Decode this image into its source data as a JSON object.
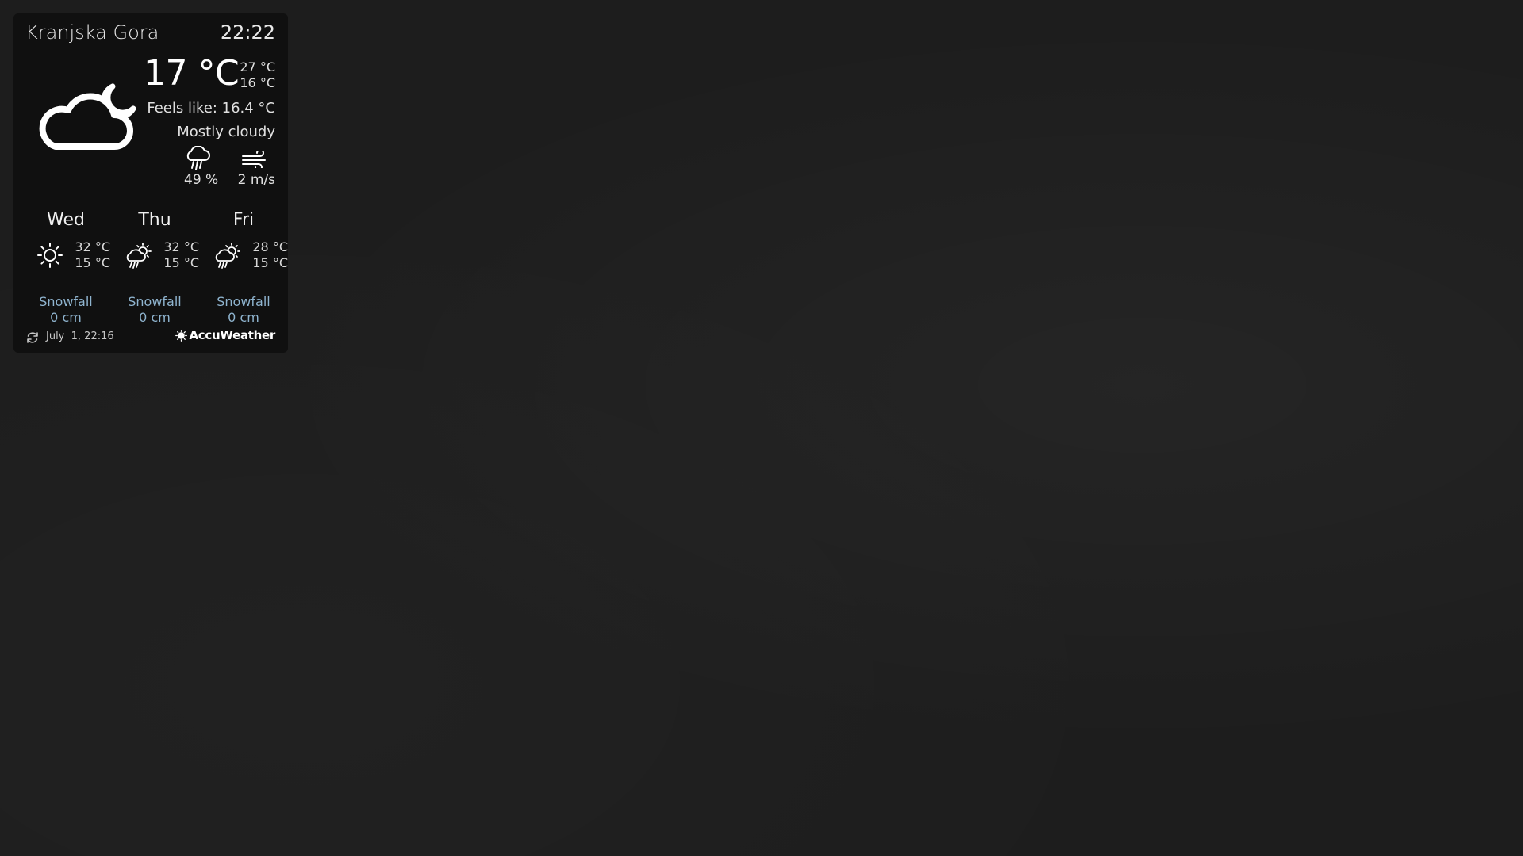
{
  "location": "Kranjska Gora",
  "time": "22:22",
  "current": {
    "icon": "cloud-moon-icon",
    "temperature": "17 °C",
    "high": "27 °C",
    "low": "16 °C",
    "feels_like": "Feels like: 16.4 °C",
    "condition": "Mostly cloudy",
    "precipitation": "49 %",
    "wind": "2 m/s"
  },
  "forecast": [
    {
      "day": "Wed",
      "icon": "sun-icon",
      "high": "32 °C",
      "low": "15 °C",
      "snow_label": "Snowfall",
      "snow_value": "0 cm"
    },
    {
      "day": "Thu",
      "icon": "sun-cloud-rain-icon",
      "high": "32 °C",
      "low": "15 °C",
      "snow_label": "Snowfall",
      "snow_value": "0 cm"
    },
    {
      "day": "Fri",
      "icon": "sun-cloud-rain-icon",
      "high": "28 °C",
      "low": "15 °C",
      "snow_label": "Snowfall",
      "snow_value": "0 cm"
    }
  ],
  "footer": {
    "updated": "July  1, 22:16",
    "brand": "AccuWeather"
  },
  "colors": {
    "snow_text": "#8fb4cf",
    "panel": "#0f0f0f",
    "background": "#1d1d1d"
  }
}
